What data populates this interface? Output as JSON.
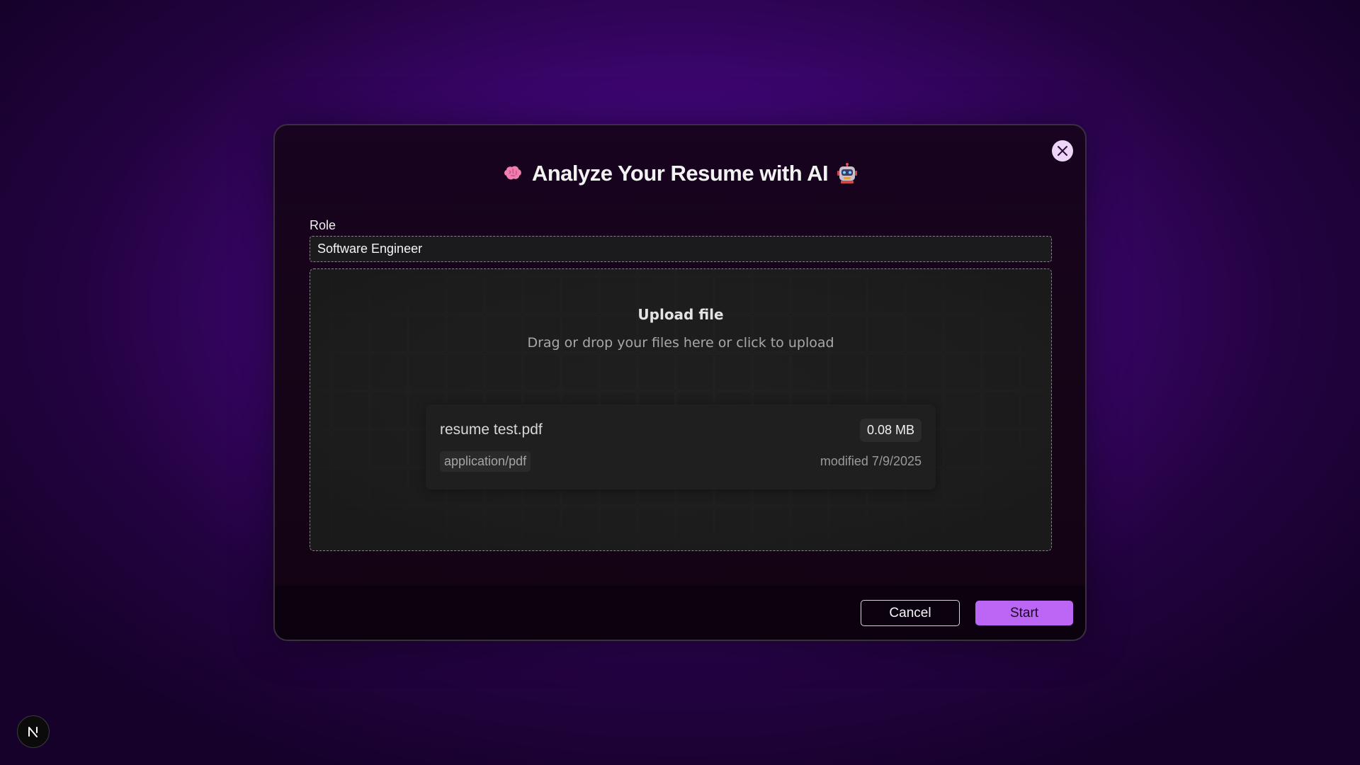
{
  "modal": {
    "title": "Analyze Your Resume with AI",
    "title_left_icon": "brain-icon",
    "title_right_icon": "robot-icon",
    "close_icon": "close-icon"
  },
  "role": {
    "label": "Role",
    "value": "Software Engineer"
  },
  "upload": {
    "title": "Upload file",
    "subtitle": "Drag or drop your files here or click to upload",
    "file": {
      "name": "resume test.pdf",
      "size": "0.08 MB",
      "type": "application/pdf",
      "modified": "modified 7/9/2025"
    }
  },
  "footer": {
    "cancel_label": "Cancel",
    "start_label": "Start"
  },
  "dev_indicator": {
    "label": "N"
  },
  "colors": {
    "accent": "#bb66f5",
    "background": "#3f0675",
    "modal_bg": "#160418"
  }
}
